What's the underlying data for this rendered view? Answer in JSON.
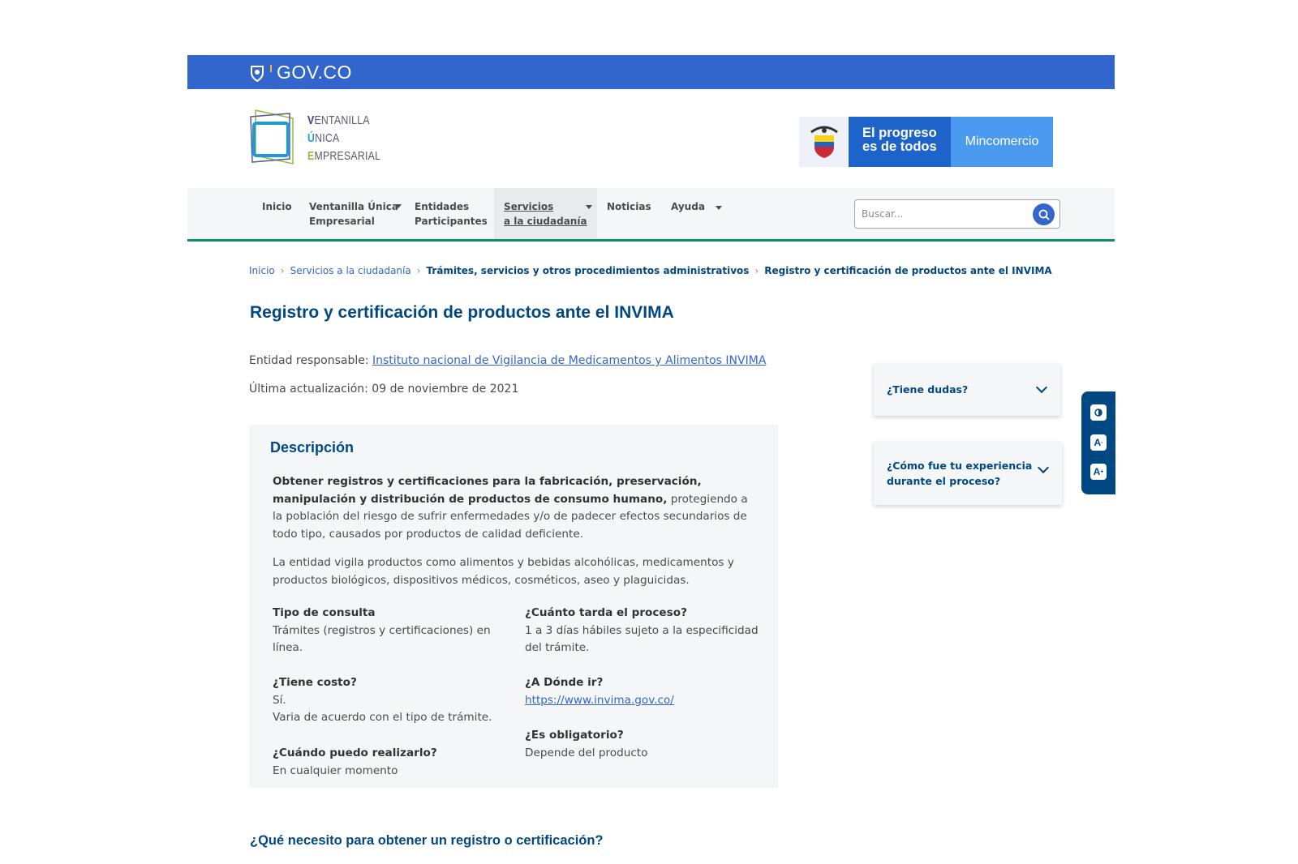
{
  "gov_bar": {
    "logo_text": "GOV.CO",
    "color": "#3366cc"
  },
  "header": {
    "vue_logo": {
      "line1_initial": "V",
      "line1_rest": "ENTANILLA",
      "line2_initial": "Ú",
      "line2_rest": "NICA",
      "line3_initial": "E",
      "line3_rest": "MPRESARIAL"
    },
    "brand": {
      "slogan_line1": "El progreso",
      "slogan_line2": "es de todos",
      "ministry": "Mincomercio"
    }
  },
  "nav": {
    "items": [
      {
        "label": "Inicio",
        "label2": ""
      },
      {
        "label": "Ventanilla Única",
        "label2": "Empresarial"
      },
      {
        "label": "Entidades",
        "label2": "Participantes"
      },
      {
        "label": "Servicios",
        "label2": "a la ciudadanía"
      },
      {
        "label": "Noticias",
        "label2": ""
      },
      {
        "label": "Ayuda",
        "label2": ""
      }
    ],
    "search_placeholder": "Buscar...",
    "accent": "#069169"
  },
  "breadcrumb": [
    "Inicio",
    "Servicios a la ciudadanía",
    "Trámites, servicios y otros procedimientos administrativos",
    "Registro y certificación de productos ante el INVIMA"
  ],
  "page": {
    "title": "Registro y certificación de productos ante el INVIMA",
    "entity_label": "Entidad responsable:",
    "entity_link": "Instituto nacional de Vigilancia de Medicamentos y Alimentos INVIMA",
    "updated": "Última actualización: 09 de noviembre de 2021"
  },
  "description": {
    "title": "Descripción",
    "p1_bold": "Obtener registros y certificaciones para la fabricación, preservación, manipulación y distribución de productos de consumo humano,",
    "p1_rest": " protegiendo a la población del riesgo de sufrir enfermedades y/o de padecer efectos secundarios de todo tipo, causados por productos de calidad deficiente.",
    "p2": "La entidad vigila productos como alimentos y bebidas alcohólicas, medicamentos y productos biológicos, dispositivos médicos, cosméticos, aseo y plaguicidas.",
    "facts": {
      "tipo_q": "Tipo de consulta",
      "tipo_a": "Trámites (registros y certificaciones) en línea.",
      "tarda_q": "¿Cuánto tarda el proceso?",
      "tarda_a": "1 a 3 días hábiles sujeto a la especificidad del trámite.",
      "costo_q": "¿Tiene costo?",
      "costo_a1": "Sí.",
      "costo_a2": "Varia de acuerdo con el tipo de trámite.",
      "donde_q": "¿A Dónde ir?",
      "donde_a": "https://www.invima.gov.co/",
      "oblig_q": "¿Es obligatorio?",
      "oblig_a": "Depende del producto",
      "cuando_q": "¿Cuándo puedo realizarlo?",
      "cuando_a": "En cualquier momento"
    }
  },
  "sidebar": {
    "dudas": "¿Tiene dudas?",
    "experiencia_line1": "¿Cómo fue tu experiencia",
    "experiencia_line2": "durante el proceso?"
  },
  "a11y": {
    "contrast_icon": "contrast-icon",
    "decrease_label": "A",
    "increase_label": "A"
  },
  "section_heading": "¿Qué necesito para obtener un registro o certificación?"
}
